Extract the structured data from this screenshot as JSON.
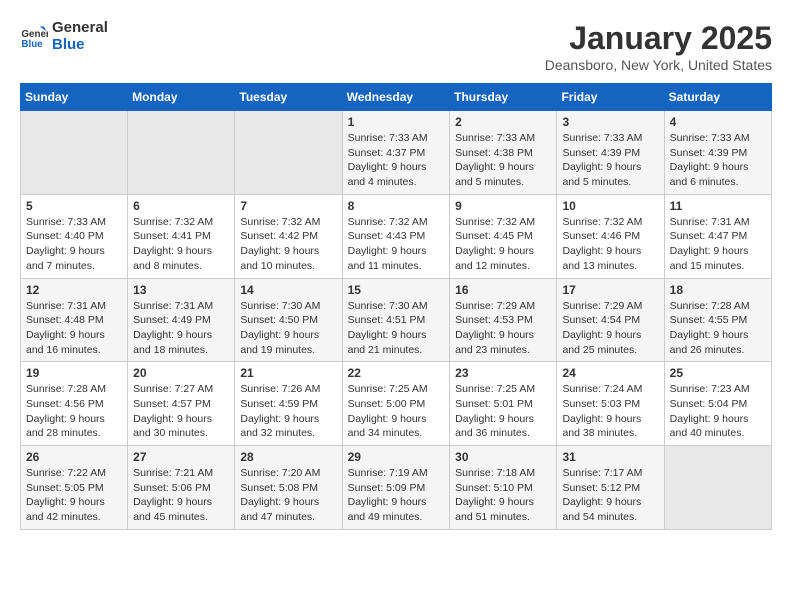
{
  "header": {
    "logo_line1": "General",
    "logo_line2": "Blue",
    "title": "January 2025",
    "subtitle": "Deansboro, New York, United States"
  },
  "weekdays": [
    "Sunday",
    "Monday",
    "Tuesday",
    "Wednesday",
    "Thursday",
    "Friday",
    "Saturday"
  ],
  "weeks": [
    [
      {
        "day": "",
        "info": ""
      },
      {
        "day": "",
        "info": ""
      },
      {
        "day": "",
        "info": ""
      },
      {
        "day": "1",
        "info": "Sunrise: 7:33 AM\nSunset: 4:37 PM\nDaylight: 9 hours and 4 minutes."
      },
      {
        "day": "2",
        "info": "Sunrise: 7:33 AM\nSunset: 4:38 PM\nDaylight: 9 hours and 5 minutes."
      },
      {
        "day": "3",
        "info": "Sunrise: 7:33 AM\nSunset: 4:39 PM\nDaylight: 9 hours and 5 minutes."
      },
      {
        "day": "4",
        "info": "Sunrise: 7:33 AM\nSunset: 4:39 PM\nDaylight: 9 hours and 6 minutes."
      }
    ],
    [
      {
        "day": "5",
        "info": "Sunrise: 7:33 AM\nSunset: 4:40 PM\nDaylight: 9 hours and 7 minutes."
      },
      {
        "day": "6",
        "info": "Sunrise: 7:32 AM\nSunset: 4:41 PM\nDaylight: 9 hours and 8 minutes."
      },
      {
        "day": "7",
        "info": "Sunrise: 7:32 AM\nSunset: 4:42 PM\nDaylight: 9 hours and 10 minutes."
      },
      {
        "day": "8",
        "info": "Sunrise: 7:32 AM\nSunset: 4:43 PM\nDaylight: 9 hours and 11 minutes."
      },
      {
        "day": "9",
        "info": "Sunrise: 7:32 AM\nSunset: 4:45 PM\nDaylight: 9 hours and 12 minutes."
      },
      {
        "day": "10",
        "info": "Sunrise: 7:32 AM\nSunset: 4:46 PM\nDaylight: 9 hours and 13 minutes."
      },
      {
        "day": "11",
        "info": "Sunrise: 7:31 AM\nSunset: 4:47 PM\nDaylight: 9 hours and 15 minutes."
      }
    ],
    [
      {
        "day": "12",
        "info": "Sunrise: 7:31 AM\nSunset: 4:48 PM\nDaylight: 9 hours and 16 minutes."
      },
      {
        "day": "13",
        "info": "Sunrise: 7:31 AM\nSunset: 4:49 PM\nDaylight: 9 hours and 18 minutes."
      },
      {
        "day": "14",
        "info": "Sunrise: 7:30 AM\nSunset: 4:50 PM\nDaylight: 9 hours and 19 minutes."
      },
      {
        "day": "15",
        "info": "Sunrise: 7:30 AM\nSunset: 4:51 PM\nDaylight: 9 hours and 21 minutes."
      },
      {
        "day": "16",
        "info": "Sunrise: 7:29 AM\nSunset: 4:53 PM\nDaylight: 9 hours and 23 minutes."
      },
      {
        "day": "17",
        "info": "Sunrise: 7:29 AM\nSunset: 4:54 PM\nDaylight: 9 hours and 25 minutes."
      },
      {
        "day": "18",
        "info": "Sunrise: 7:28 AM\nSunset: 4:55 PM\nDaylight: 9 hours and 26 minutes."
      }
    ],
    [
      {
        "day": "19",
        "info": "Sunrise: 7:28 AM\nSunset: 4:56 PM\nDaylight: 9 hours and 28 minutes."
      },
      {
        "day": "20",
        "info": "Sunrise: 7:27 AM\nSunset: 4:57 PM\nDaylight: 9 hours and 30 minutes."
      },
      {
        "day": "21",
        "info": "Sunrise: 7:26 AM\nSunset: 4:59 PM\nDaylight: 9 hours and 32 minutes."
      },
      {
        "day": "22",
        "info": "Sunrise: 7:25 AM\nSunset: 5:00 PM\nDaylight: 9 hours and 34 minutes."
      },
      {
        "day": "23",
        "info": "Sunrise: 7:25 AM\nSunset: 5:01 PM\nDaylight: 9 hours and 36 minutes."
      },
      {
        "day": "24",
        "info": "Sunrise: 7:24 AM\nSunset: 5:03 PM\nDaylight: 9 hours and 38 minutes."
      },
      {
        "day": "25",
        "info": "Sunrise: 7:23 AM\nSunset: 5:04 PM\nDaylight: 9 hours and 40 minutes."
      }
    ],
    [
      {
        "day": "26",
        "info": "Sunrise: 7:22 AM\nSunset: 5:05 PM\nDaylight: 9 hours and 42 minutes."
      },
      {
        "day": "27",
        "info": "Sunrise: 7:21 AM\nSunset: 5:06 PM\nDaylight: 9 hours and 45 minutes."
      },
      {
        "day": "28",
        "info": "Sunrise: 7:20 AM\nSunset: 5:08 PM\nDaylight: 9 hours and 47 minutes."
      },
      {
        "day": "29",
        "info": "Sunrise: 7:19 AM\nSunset: 5:09 PM\nDaylight: 9 hours and 49 minutes."
      },
      {
        "day": "30",
        "info": "Sunrise: 7:18 AM\nSunset: 5:10 PM\nDaylight: 9 hours and 51 minutes."
      },
      {
        "day": "31",
        "info": "Sunrise: 7:17 AM\nSunset: 5:12 PM\nDaylight: 9 hours and 54 minutes."
      },
      {
        "day": "",
        "info": ""
      }
    ]
  ]
}
